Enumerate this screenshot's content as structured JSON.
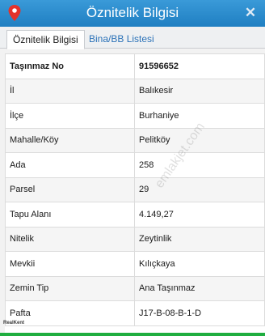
{
  "window": {
    "title": "Öznitelik Bilgisi",
    "close_glyph": "✕",
    "app_icon": "location-pin-icon",
    "accent_color": "#2a8bcf"
  },
  "tabs": [
    {
      "label": "Öznitelik Bilgisi",
      "active": true
    },
    {
      "label": "Bina/BB Listesi",
      "active": false
    }
  ],
  "table": {
    "header": {
      "key": "Taşınmaz No",
      "value": "91596652"
    },
    "rows": [
      {
        "key": "İl",
        "value": "Balıkesir"
      },
      {
        "key": "İlçe",
        "value": "Burhaniye"
      },
      {
        "key": "Mahalle/Köy",
        "value": "Pelitköy"
      },
      {
        "key": "Ada",
        "value": "258"
      },
      {
        "key": "Parsel",
        "value": "29"
      },
      {
        "key": "Tapu Alanı",
        "value": "4.149,27"
      },
      {
        "key": "Nitelik",
        "value": "Zeytinlik"
      },
      {
        "key": "Mevkii",
        "value": "Kılıçkaya"
      },
      {
        "key": "Zemin Tip",
        "value": "Ana Taşınmaz"
      },
      {
        "key": "Pafta",
        "value": "J17-B-08-B-1-D"
      }
    ]
  },
  "watermark": {
    "text": "emlakjet.com",
    "logo_text": "RealKent"
  }
}
